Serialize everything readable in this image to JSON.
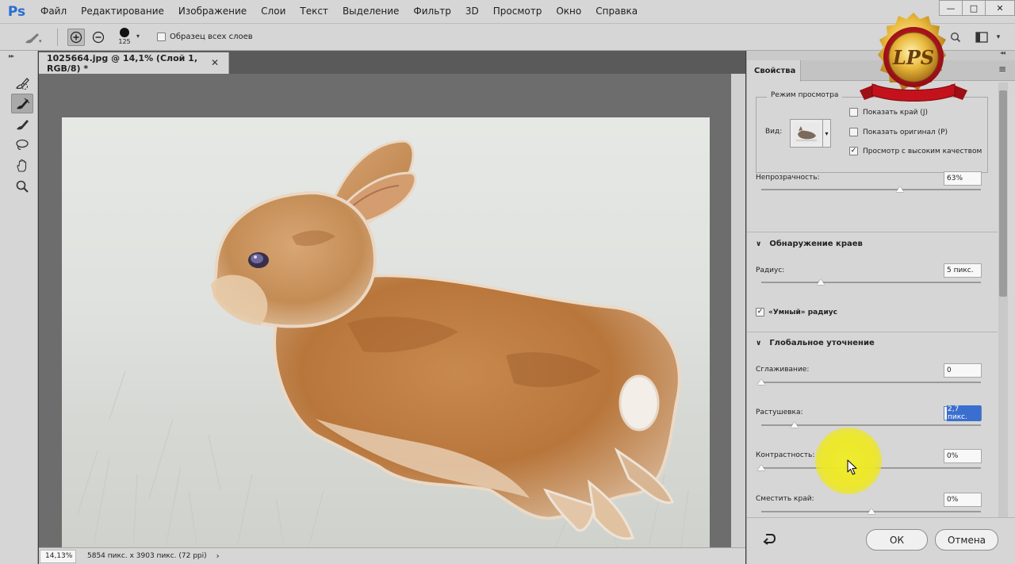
{
  "app": {
    "logo": "Ps"
  },
  "menu": [
    "Файл",
    "Редактирование",
    "Изображение",
    "Слои",
    "Текст",
    "Выделение",
    "Фильтр",
    "3D",
    "Просмотр",
    "Окно",
    "Справка"
  ],
  "window_controls": {
    "minimize": "—",
    "maximize": "□",
    "close": "✕"
  },
  "options_bar": {
    "brush_size": "125",
    "sample_all_layers": "Образец всех слоев",
    "sample_all_layers_checked": false
  },
  "tools": [
    "quick-selection-brush",
    "refine-edge-brush",
    "brush",
    "lasso",
    "hand",
    "zoom"
  ],
  "document": {
    "tab_title": "1025664.jpg @ 14,1% (Слой 1, RGB/8) *",
    "close_glyph": "✕"
  },
  "status_bar": {
    "zoom": "14,13%",
    "info": "5854 пикс. x 3903 пикс. (72 ppi)",
    "arrow": "›"
  },
  "properties": {
    "tab": "Свойства",
    "view_mode": {
      "title": "Режим просмотра",
      "view_label": "Вид:",
      "options": [
        {
          "label": "Показать край (J)",
          "checked": false
        },
        {
          "label": "Показать оригинал (P)",
          "checked": false
        },
        {
          "label": "Просмотр с высоким качеством",
          "checked": true
        }
      ]
    },
    "opacity": {
      "label": "Непрозрачность:",
      "value": "63%",
      "level": 0.63
    },
    "edge_detection": {
      "title": "Обнаружение краев",
      "radius": {
        "label": "Радиус:",
        "value": "5 пикс.",
        "level": 0.27
      },
      "smart_radius": {
        "label": "«Умный» радиус",
        "checked": true
      }
    },
    "global_refinements": {
      "title": "Глобальное уточнение",
      "smooth": {
        "label": "Сглаживание:",
        "value": "0",
        "level": 0
      },
      "feather": {
        "label": "Растушевка:",
        "value": "2,7 пикс.",
        "level": 0.15
      },
      "contrast": {
        "label": "Контрастность:",
        "value": "0%",
        "level": 0
      },
      "shift_edge": {
        "label": "Сместить край:",
        "value": "0%",
        "level": 0.5
      }
    },
    "ok": "ОК",
    "cancel": "Отмена"
  },
  "badge": {
    "text": "LPS",
    "colors": {
      "gold": "#e8b83a",
      "red": "#c4121c"
    }
  },
  "colors": {
    "cursor_highlight": "#f0ec28",
    "selection": "#3b6fcf",
    "app_blue": "#2b6dd1"
  }
}
